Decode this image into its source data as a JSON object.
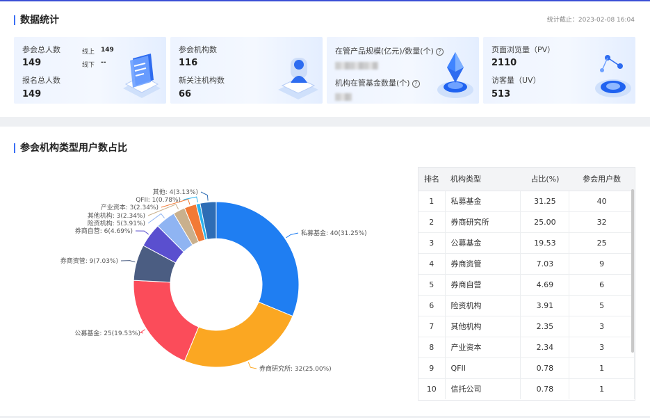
{
  "stats_panel": {
    "title": "数据统计",
    "stamp": "统计截止：2023-02-08 16:04",
    "cards": {
      "attendees": {
        "total_label": "参会总人数",
        "total_value": "149",
        "online_label": "线上",
        "online_value": "149",
        "offline_label": "线下",
        "offline_value": "--",
        "registered_label": "报名总人数",
        "registered_value": "149"
      },
      "institutions": {
        "count_label": "参会机构数",
        "count_value": "116",
        "new_label": "新关注机构数",
        "new_value": "66"
      },
      "products": {
        "aum_label": "在管产品规模(亿元)/数量(个)",
        "funds_label": "机构在管基金数量(个)",
        "help_icon": "question-circle-icon"
      },
      "traffic": {
        "pv_label": "页面浏览量（PV）",
        "pv_value": "2110",
        "uv_label": "访客量（UV）",
        "uv_value": "513"
      }
    }
  },
  "type_panel": {
    "title": "参会机构类型用户数占比",
    "table": {
      "headers": [
        "排名",
        "机构类型",
        "占比(%)",
        "参会用户数"
      ],
      "rows": [
        [
          "1",
          "私募基金",
          "31.25",
          "40"
        ],
        [
          "2",
          "券商研究所",
          "25.00",
          "32"
        ],
        [
          "3",
          "公募基金",
          "19.53",
          "25"
        ],
        [
          "4",
          "券商资管",
          "7.03",
          "9"
        ],
        [
          "5",
          "券商自营",
          "4.69",
          "6"
        ],
        [
          "6",
          "险资机构",
          "3.91",
          "5"
        ],
        [
          "7",
          "其他机构",
          "2.35",
          "3"
        ],
        [
          "8",
          "产业资本",
          "2.34",
          "3"
        ],
        [
          "9",
          "QFII",
          "0.78",
          "1"
        ],
        [
          "10",
          "信托公司",
          "0.78",
          "1"
        ]
      ]
    }
  },
  "chart_data": {
    "type": "pie",
    "donut": true,
    "categories": [
      "私募基金",
      "券商研究所",
      "公募基金",
      "券商资管",
      "券商自营",
      "险资机构",
      "其他机构",
      "产业资本",
      "QFII",
      "其他"
    ],
    "values": [
      40,
      32,
      25,
      9,
      6,
      5,
      3,
      3,
      1,
      4
    ],
    "labels": [
      "私募基金: 40(31.25%)",
      "券商研究所: 32(25.00%)",
      "公募基金: 25(19.53%)",
      "券商资管: 9(7.03%)",
      "券商自营: 6(4.69%)",
      "险资机构: 5(3.91%)",
      "其他机构: 3(2.34%)",
      "产业资本: 3(2.34%)",
      "QFII: 1(0.78%)",
      "其他: 4(3.13%)"
    ],
    "colors": [
      "#1f7ef2",
      "#fba722",
      "#fb4c5a",
      "#4b5d82",
      "#5a4fcf",
      "#8fb4f2",
      "#c9b08d",
      "#f27a36",
      "#2cb3ee",
      "#2e6db5"
    ]
  }
}
